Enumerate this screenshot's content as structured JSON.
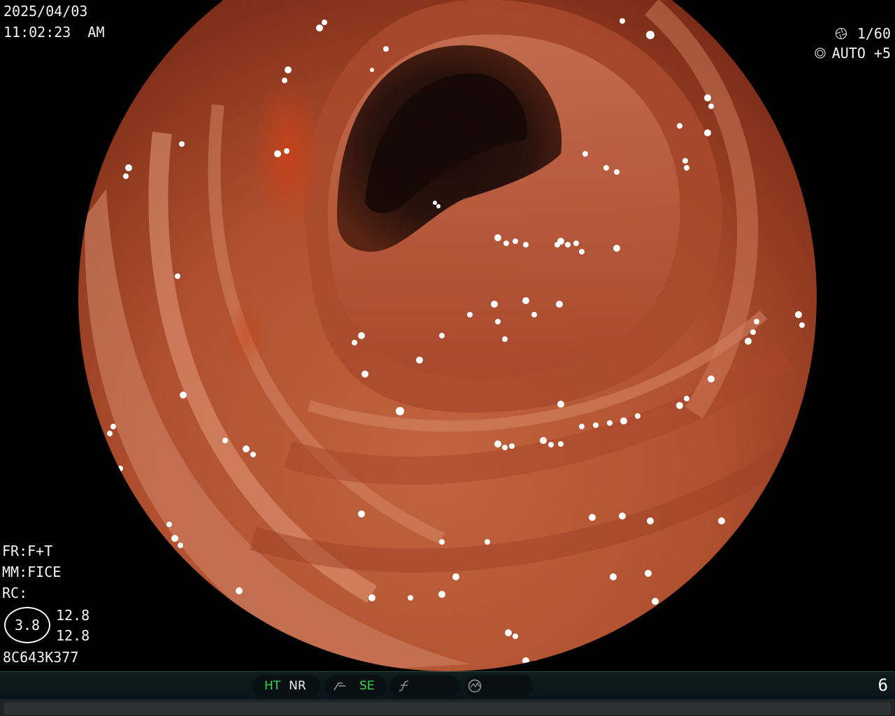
{
  "osd": {
    "date": "2025/04/03",
    "time": "11:02:23  AM",
    "shutter": "1/60",
    "exposure": "AUTO +5",
    "fr": "FR:F+T",
    "mm": "MM:FICE",
    "rc": "RC:",
    "zoom": "3.8",
    "value_1": "12.8",
    "value_2": "12.8",
    "serial": "8C643K377",
    "frame_number": "6"
  },
  "status_bar": {
    "mode_ht": "HT",
    "mode_nr": "NR",
    "mode_se": "SE",
    "icons": [
      "shutter-icon",
      "exposure-icon",
      "curve-icon",
      "f-icon",
      "ring-icon"
    ]
  },
  "colors": {
    "active_mode": "#33d94a",
    "osd_text": "#f4f4f4",
    "status_bg": "#0e1c1f",
    "mucosa": "#b8553a",
    "lumen": "#1a0d0a"
  }
}
